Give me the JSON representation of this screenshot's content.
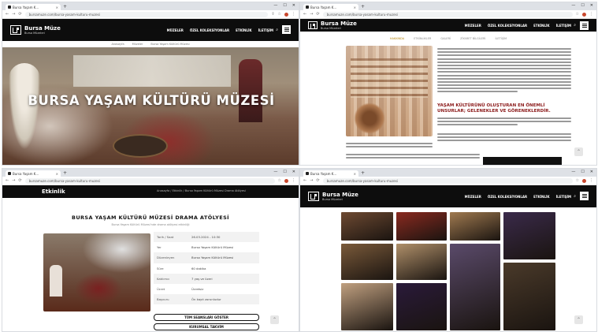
{
  "browser": {
    "tab_title": "Bursa Yaşam K…",
    "url": "bursamuze.com/bursa-yasam-kulturu-muzesi",
    "new_tab": "+",
    "tab_close": "×",
    "win_min": "—",
    "win_max": "☐",
    "win_close": "✕"
  },
  "site": {
    "logo_title": "Bursa Müze",
    "logo_subtitle": "Bursa Müzeleri",
    "menu": [
      "MÜZELER",
      "ÖZEL KOLEKSİYONLAR",
      "ETKİNLİK",
      "İLETİŞİM"
    ],
    "search_icon": "search-icon",
    "menu_icon": "hamburger-icon"
  },
  "window1": {
    "breadcrumb": [
      "Anasayfa",
      "Müzeler",
      "Bursa Yaşam Kültürü Müzesi"
    ],
    "hero_title": "BURSA YAŞAM KÜLTÜRÜ MÜZESİ"
  },
  "window2": {
    "subnav": [
      "HAKKINDA",
      "ETKİNLİKLER",
      "GALERİ",
      "ZİYARET BİLGİLERİ",
      "İLETİŞİM"
    ],
    "heading": "YAŞAM KÜLTÜRÜNÜ OLUŞTURAN EN ÖNEMLİ UNSURLAR; GELENEKLER VE GÖRENEKLERDİR."
  },
  "window3": {
    "page_label": "Etkinlik",
    "breadcrumb": "Anasayfa  /  Etkinlik  /  Bursa Yaşam Kültürü Müzesi Drama Atölyesi",
    "event_title": "BURSA YAŞAM KÜLTÜRÜ MÜZESİ DRAMA ATÖLYESİ",
    "event_subtitle": "Bursa Yaşam Kültürü Müzesi'nde drama atölyesi etkinliği",
    "details": [
      {
        "key": "Tarih / Saat",
        "value": "26.03.2024 - 10:30"
      },
      {
        "key": "Yer",
        "value": "Bursa Yaşam Kültürü Müzesi"
      },
      {
        "key": "Düzenleyen",
        "value": "Bursa Yaşam Kültürü Müzesi"
      },
      {
        "key": "Süre",
        "value": "60 dakika"
      },
      {
        "key": "Katılımcı",
        "value": "7 yaş ve üzeri"
      },
      {
        "key": "Ücret",
        "value": "Ücretsiz"
      },
      {
        "key": "Başvuru",
        "value": "Ön kayıt zorunludur"
      }
    ],
    "btn_all_sessions": "TÜM SEANSLARI GÖSTER",
    "btn_calendar": "KURUMSAL TAKVİM"
  },
  "colors": {
    "header_bg": "#0d0d0d",
    "accent_red": "#8b1a1a",
    "accent_gold": "#b8860b"
  },
  "gallery": {
    "tiles": [
      {
        "color": "#6e4a32"
      },
      {
        "color": "#8a2a20"
      },
      {
        "color": "#a07a50"
      },
      {
        "color": "#3a2a4a"
      },
      {
        "color": "#7a5a3a"
      },
      {
        "color": "#b0906a"
      },
      {
        "color": "#5a4a6a"
      },
      {
        "color": "#4a3a2a"
      },
      {
        "color": "#c0a080"
      },
      {
        "color": "#2a1a3a"
      },
      {
        "color": "#9a6a40"
      },
      {
        "color": "#705030"
      }
    ]
  }
}
